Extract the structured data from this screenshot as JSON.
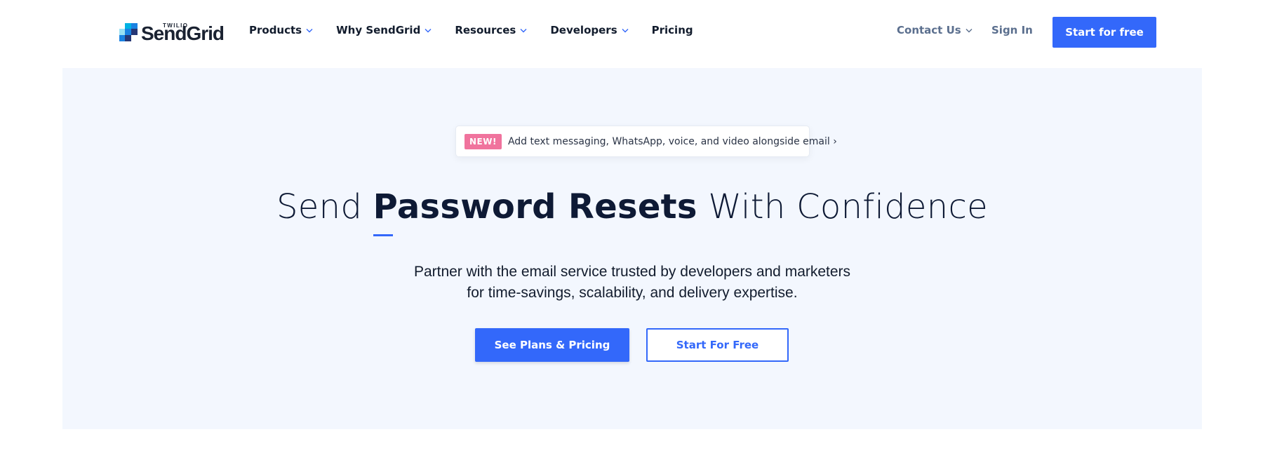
{
  "brand": {
    "logo_super": "TWILIO",
    "logo_text": "SendGrid",
    "colors": {
      "accent": "#3368fa",
      "logo_squares": [
        "#1a82e2",
        "#00b2e3",
        "#99e1f4",
        "#263775"
      ],
      "badge": "#f0739d",
      "hero_background": "#f3f7fe",
      "muted_nav": "#5b6f8e"
    }
  },
  "nav": {
    "items": [
      {
        "label": "Products",
        "has_dropdown": true
      },
      {
        "label": "Why SendGrid",
        "has_dropdown": true
      },
      {
        "label": "Resources",
        "has_dropdown": true
      },
      {
        "label": "Developers",
        "has_dropdown": true
      },
      {
        "label": "Pricing",
        "has_dropdown": false
      }
    ],
    "contact_label": "Contact Us",
    "signin_label": "Sign In",
    "cta_label": "Start for free",
    "dropdown_icon": "chevron-down-icon"
  },
  "hero": {
    "announcement": {
      "badge": "NEW!",
      "text": "Add text messaging, WhatsApp, voice, and video alongside email ›"
    },
    "headline": {
      "prefix": "Send ",
      "emphasis": "Password Resets",
      "suffix": " With Confidence"
    },
    "subtext": {
      "line1": "Partner with the email service trusted by developers and marketers",
      "line2": "for time-savings, scalability, and delivery expertise."
    },
    "primary_button": "See Plans & Pricing",
    "secondary_button": "Start For Free"
  }
}
